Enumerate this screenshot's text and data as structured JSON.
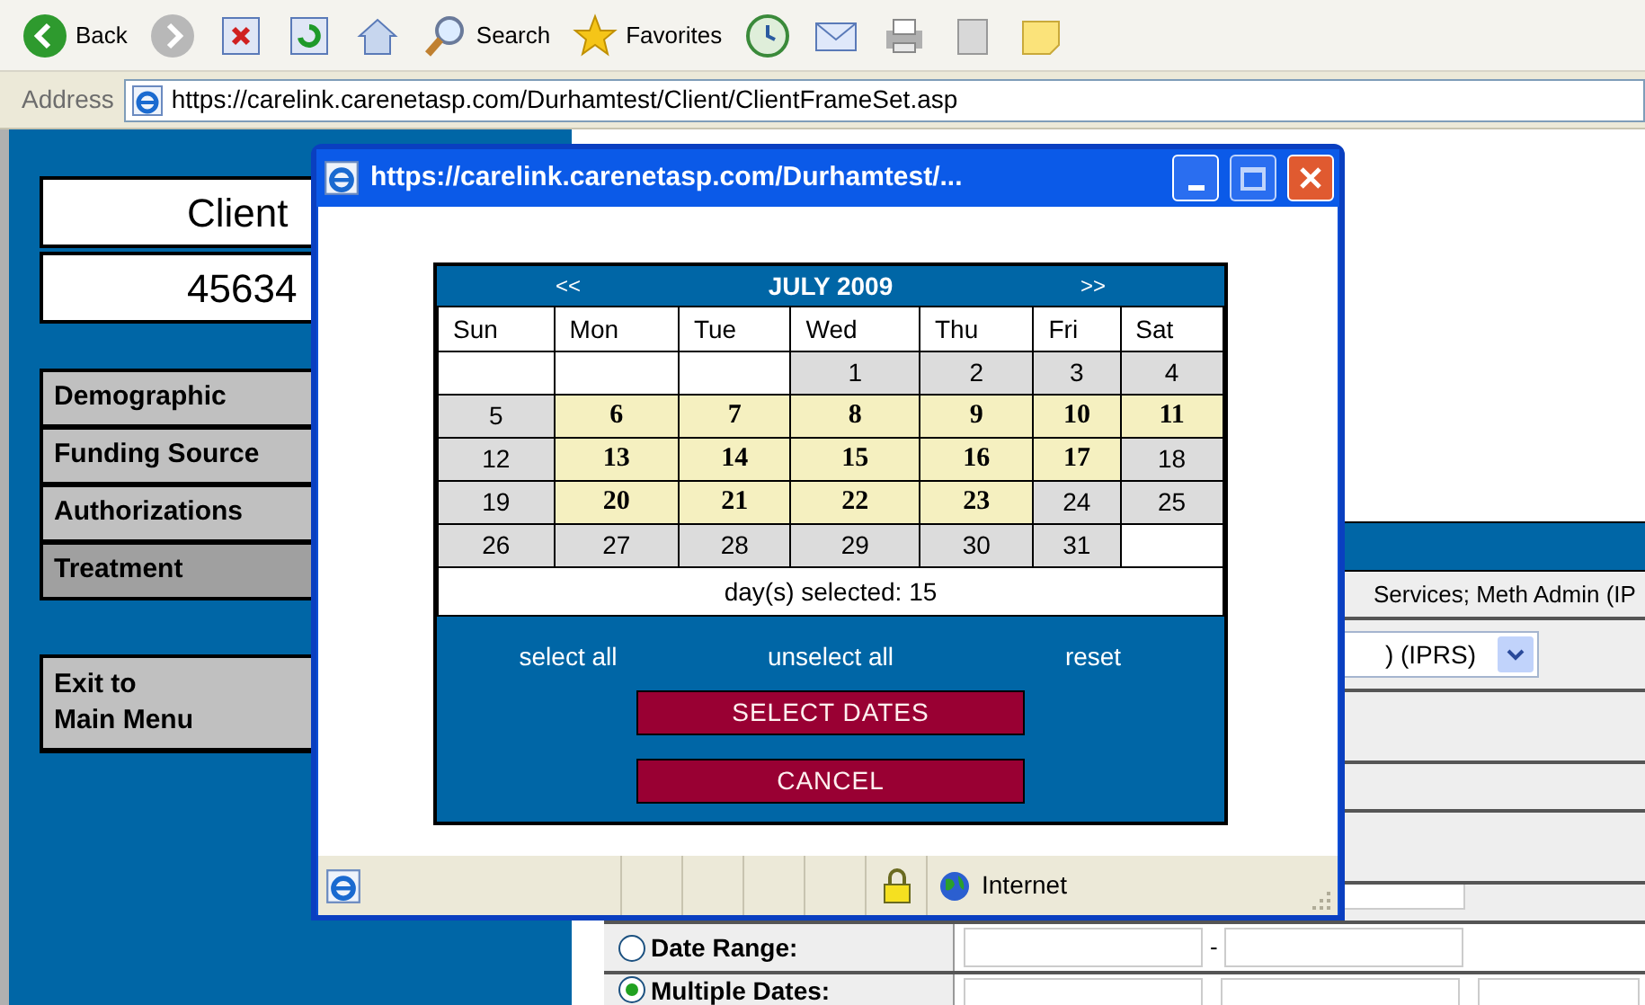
{
  "toolbar": {
    "buttons": [
      {
        "kind": "back",
        "label": "Back"
      },
      {
        "kind": "forward"
      },
      {
        "kind": "stop"
      },
      {
        "kind": "refresh"
      },
      {
        "kind": "home"
      },
      {
        "kind": "search",
        "label": "Search"
      },
      {
        "kind": "favorites",
        "label": "Favorites"
      },
      {
        "kind": "history"
      },
      {
        "kind": "mail"
      },
      {
        "kind": "print"
      },
      {
        "kind": "edit"
      },
      {
        "kind": "note"
      }
    ]
  },
  "address_bar": {
    "label": "Address",
    "url": "https://carelink.carenetasp.com/Durhamtest/Client/ClientFrameSet.asp"
  },
  "client_panel": {
    "title": "Client",
    "number": "45634"
  },
  "nav": [
    {
      "label": "Demographic",
      "selected": false
    },
    {
      "label": "Funding Source",
      "selected": false
    },
    {
      "label": "Authorizations",
      "selected": false
    },
    {
      "label": "Treatment",
      "selected": true
    }
  ],
  "exit_button": [
    "Exit to",
    "Main Menu"
  ],
  "form": {
    "service_text": "Services; Meth Admin (IP",
    "program_select": ") (IPRS)",
    "range_separator": "-",
    "date_options": [
      {
        "label": "Date Range:",
        "selected": false
      },
      {
        "label": "Multiple Dates:",
        "selected": true
      }
    ]
  },
  "popup": {
    "title": "https://carelink.carenetasp.com/Durhamtest/...",
    "calendar": {
      "prev": "<<",
      "month": "JULY 2009",
      "next": ">>",
      "weekdays": [
        "Sun",
        "Mon",
        "Tue",
        "Wed",
        "Thu",
        "Fri",
        "Sat"
      ],
      "weeks": [
        [
          {
            "kind": "empty"
          },
          {
            "kind": "empty"
          },
          {
            "kind": "empty"
          },
          {
            "kind": "day",
            "day": "1",
            "selected": false
          },
          {
            "kind": "day",
            "day": "2",
            "selected": false
          },
          {
            "kind": "day",
            "day": "3",
            "selected": false
          },
          {
            "kind": "day",
            "day": "4",
            "selected": false
          }
        ],
        [
          {
            "kind": "day",
            "day": "5",
            "selected": false
          },
          {
            "kind": "day",
            "day": "6",
            "selected": true
          },
          {
            "kind": "day",
            "day": "7",
            "selected": true
          },
          {
            "kind": "day",
            "day": "8",
            "selected": true
          },
          {
            "kind": "day",
            "day": "9",
            "selected": true
          },
          {
            "kind": "day",
            "day": "10",
            "selected": true
          },
          {
            "kind": "day",
            "day": "11",
            "selected": true
          }
        ],
        [
          {
            "kind": "day",
            "day": "12",
            "selected": false
          },
          {
            "kind": "day",
            "day": "13",
            "selected": true
          },
          {
            "kind": "day",
            "day": "14",
            "selected": true
          },
          {
            "kind": "day",
            "day": "15",
            "selected": true
          },
          {
            "kind": "day",
            "day": "16",
            "selected": true
          },
          {
            "kind": "day",
            "day": "17",
            "selected": true
          },
          {
            "kind": "day",
            "day": "18",
            "selected": false
          }
        ],
        [
          {
            "kind": "day",
            "day": "19",
            "selected": false
          },
          {
            "kind": "day",
            "day": "20",
            "selected": true
          },
          {
            "kind": "day",
            "day": "21",
            "selected": true
          },
          {
            "kind": "day",
            "day": "22",
            "selected": true
          },
          {
            "kind": "day",
            "day": "23",
            "selected": true
          },
          {
            "kind": "day",
            "day": "24",
            "selected": false
          },
          {
            "kind": "day",
            "day": "25",
            "selected": false
          }
        ],
        [
          {
            "kind": "day",
            "day": "26",
            "selected": false
          },
          {
            "kind": "day",
            "day": "27",
            "selected": false
          },
          {
            "kind": "day",
            "day": "28",
            "selected": false
          },
          {
            "kind": "day",
            "day": "29",
            "selected": false
          },
          {
            "kind": "day",
            "day": "30",
            "selected": false
          },
          {
            "kind": "day",
            "day": "31",
            "selected": false
          },
          {
            "kind": "empty"
          }
        ]
      ],
      "summary_label": "day(s) selected:",
      "summary_count": "15",
      "links": [
        "select all",
        "unselect all",
        "reset"
      ],
      "buttons": [
        "SELECT DATES",
        "CANCEL"
      ]
    },
    "status": {
      "zone": "Internet",
      "secure": true
    }
  }
}
